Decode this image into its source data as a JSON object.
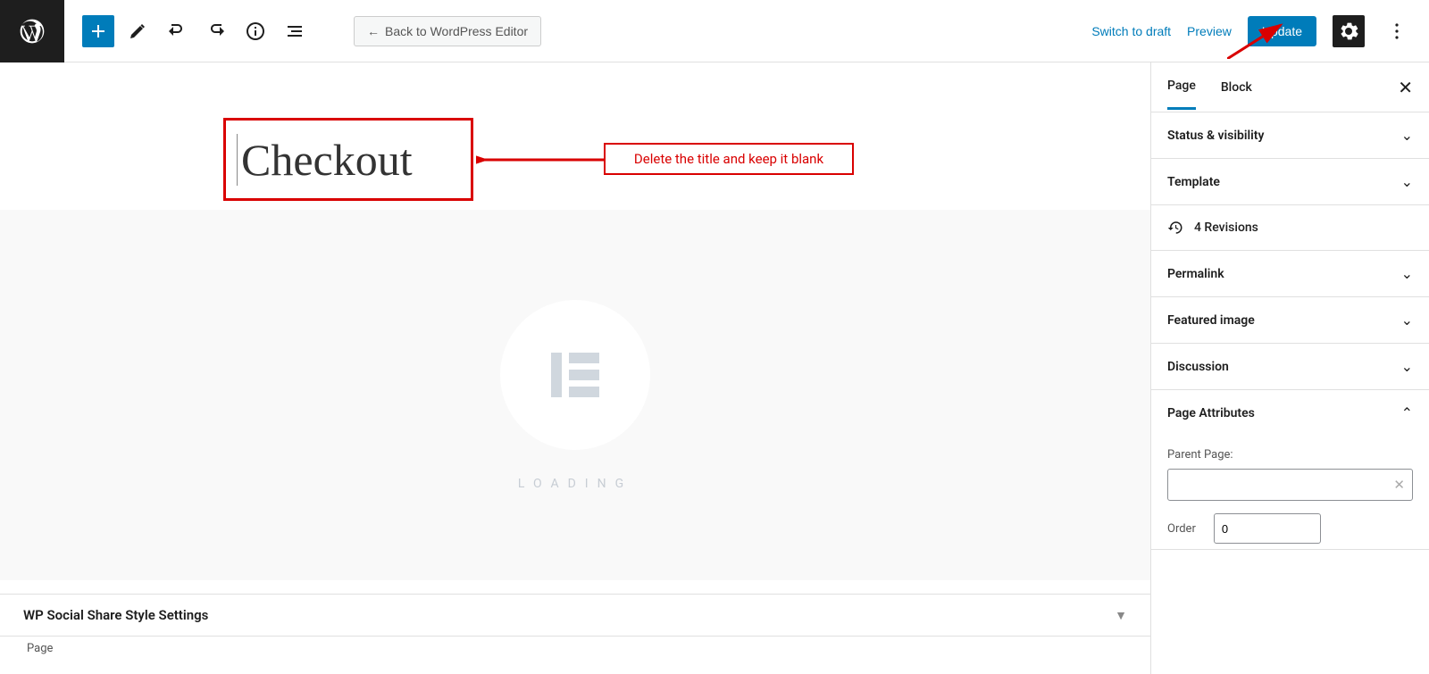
{
  "topbar": {
    "back_label": "Back to WordPress Editor",
    "switch_label": "Switch to draft",
    "preview_label": "Preview",
    "update_label": "Update"
  },
  "editor": {
    "title": "Checkout",
    "annotation_text": "Delete the title and keep it blank",
    "loading_text": "LOADING",
    "metabox_title": "WP Social Share Style Settings",
    "footer_text": "Page"
  },
  "sidebar": {
    "tabs": {
      "page": "Page",
      "block": "Block"
    },
    "panels": {
      "status": "Status & visibility",
      "template": "Template",
      "revisions_count": "4 Revisions",
      "permalink": "Permalink",
      "featured_image": "Featured image",
      "discussion": "Discussion",
      "page_attributes": "Page Attributes",
      "parent_page_label": "Parent Page:",
      "order_label": "Order",
      "order_value": "0"
    }
  }
}
